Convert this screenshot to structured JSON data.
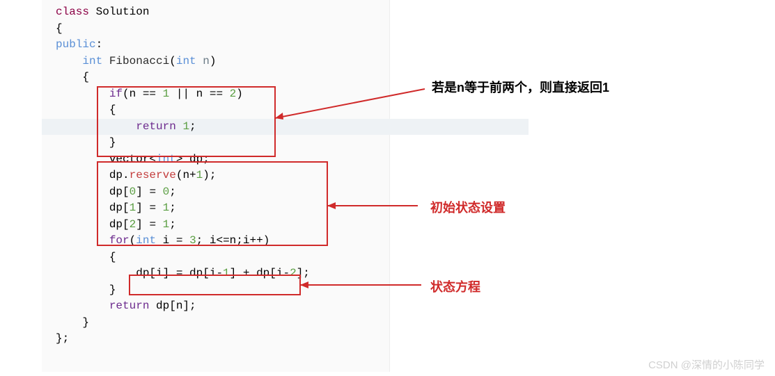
{
  "code": {
    "l1_class": "class",
    "l1_sol": " Solution",
    "l2": "{",
    "l3_pub": "public",
    "l3_colon": ":",
    "l4_int": "    int",
    "l4_fn": " Fibonacci",
    "l4_open": "(",
    "l4_pint": "int",
    "l4_n": " n",
    "l4_close": ")",
    "l5": "    {",
    "l6_if": "        if",
    "l6_rest": "(n == ",
    "l6_n1": "1",
    "l6_mid": " || n == ",
    "l6_n2": "2",
    "l6_end": ")",
    "l7": "        {",
    "l8_ret": "            return",
    "l8_sp": " ",
    "l8_n": "1",
    "l8_semi": ";",
    "l9": "        }",
    "l10_a": "        vector<",
    "l10_int": "int",
    "l10_b": "> dp;",
    "l11_a": "        dp.",
    "l11_m": "reserve",
    "l11_b": "(n+",
    "l11_n": "1",
    "l11_c": ");",
    "l12_a": "        dp[",
    "l12_i": "0",
    "l12_b": "] = ",
    "l12_v": "0",
    "l12_c": ";",
    "l13_a": "        dp[",
    "l13_i": "1",
    "l13_b": "] = ",
    "l13_v": "1",
    "l13_c": ";",
    "l14_a": "        dp[",
    "l14_i": "2",
    "l14_b": "] = ",
    "l14_v": "1",
    "l14_c": ";",
    "l15_for": "        for",
    "l15_a": "(",
    "l15_int": "int",
    "l15_b": " i = ",
    "l15_n": "3",
    "l15_c": "; i<=n;i++)",
    "l16": "        {",
    "l17_a": "            dp[i] = dp[i-",
    "l17_n1": "1",
    "l17_b": "] + dp[i-",
    "l17_n2": "2",
    "l17_c": "];",
    "l18": "        }",
    "l19_ret": "        return",
    "l19_b": " dp[n];",
    "l20": "    }",
    "l21": "};"
  },
  "annotations": {
    "top": "若是n等于前两个，则直接返回1",
    "mid": "初始状态设置",
    "bot": "状态方程"
  },
  "watermark": "CSDN @深情的小陈同学"
}
